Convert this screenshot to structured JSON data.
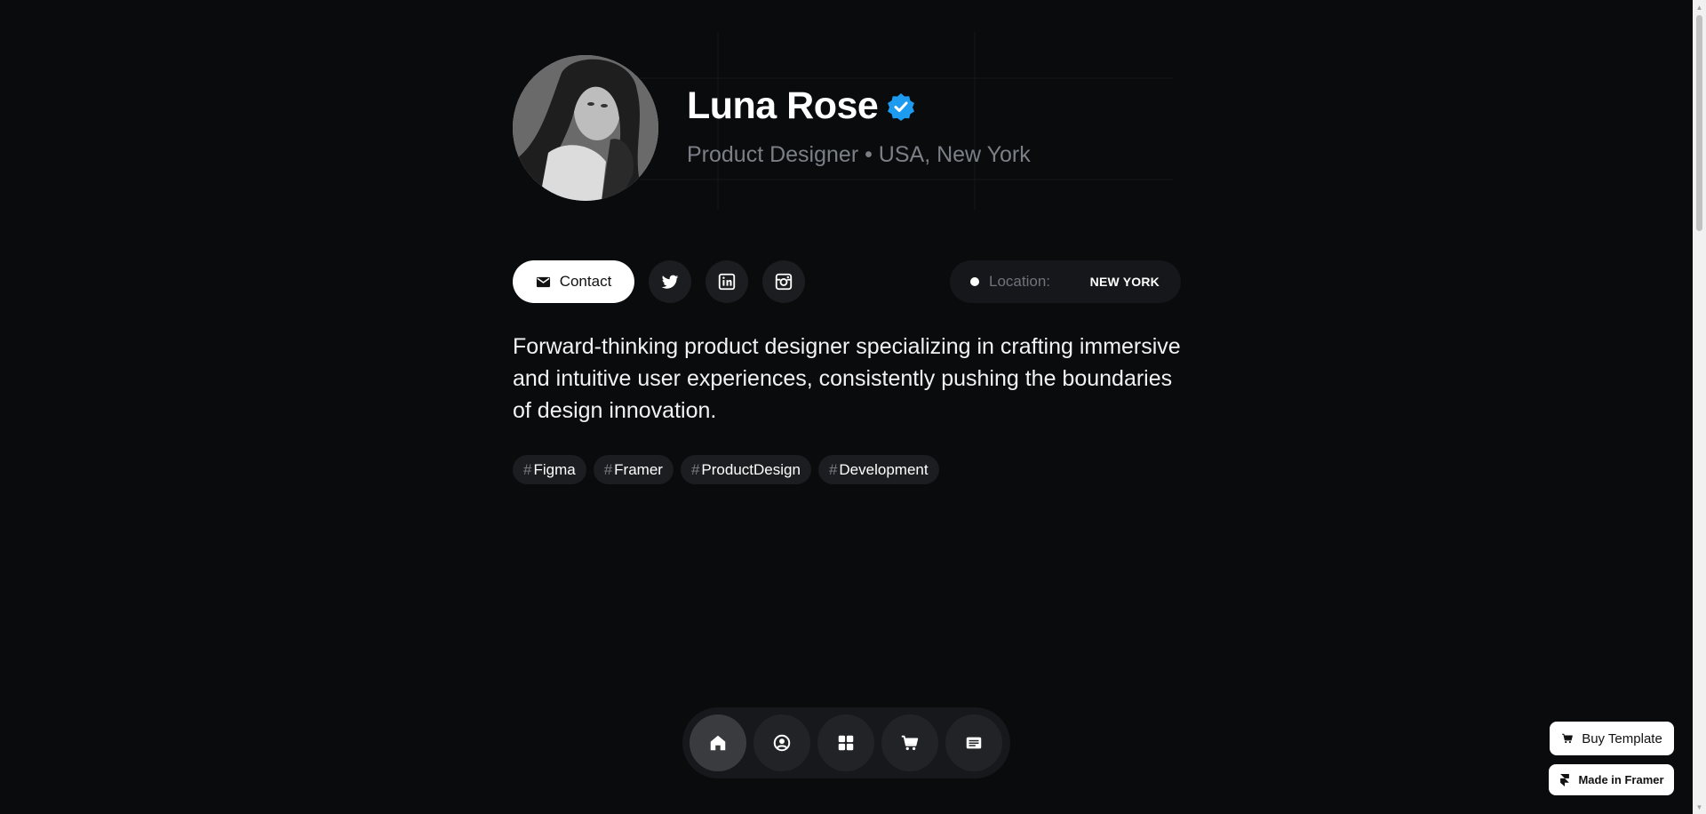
{
  "profile": {
    "name": "Luna Rose",
    "subtitle": "Product Designer • USA, New York",
    "avatar_icon": "portrait-photo",
    "verified_color": "#1d9bf0"
  },
  "actions": {
    "contact_label": "Contact",
    "social": [
      "twitter-icon",
      "linkedin-icon",
      "instagram-icon"
    ],
    "location_label": "Location:",
    "location_value": "NEW YORK"
  },
  "bio": "Forward-thinking product designer specializing in crafting immersive and intuitive user experiences, consistently pushing the boundaries of design innovation.",
  "tags": [
    {
      "hash": "#",
      "label": "Figma"
    },
    {
      "hash": "#",
      "label": "Framer"
    },
    {
      "hash": "#",
      "label": "ProductDesign"
    },
    {
      "hash": "#",
      "label": "Development"
    }
  ],
  "dock": {
    "items": [
      "home-icon",
      "profile-icon",
      "grid-icon",
      "cart-icon",
      "notes-icon"
    ],
    "active": "home-icon"
  },
  "floating": {
    "buy_label": "Buy Template",
    "framer_label": "Made in Framer"
  },
  "colors": {
    "background": "#0a0b0d",
    "surface": "#1c1d20",
    "muted_text": "#7b7f86",
    "accent": "#1d9bf0"
  }
}
